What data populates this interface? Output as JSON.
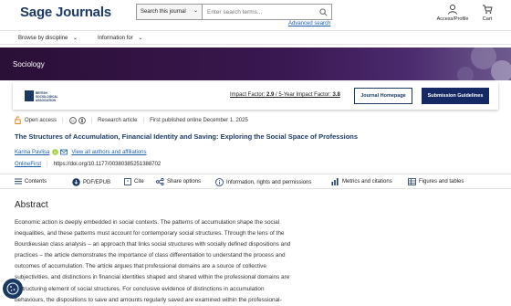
{
  "header": {
    "logo": "Sage Journals",
    "search_scope": "Search this journal",
    "search_placeholder": "Enter search terms...",
    "advanced_search": "Advanced search",
    "account_label": "Access/Profile",
    "cart_label": "Cart"
  },
  "nav": {
    "browse": "Browse by discipline",
    "info": "Information for"
  },
  "banner": {
    "title": "Sociology"
  },
  "journal": {
    "impact_factor_label": "Impact Factor:",
    "impact_factor": "2.9",
    "five_year_label": "5-Year Impact Factor:",
    "five_year": "3.8",
    "home_button": "Journal Homepage",
    "guidelines_button": "Submission Guidelines",
    "logo_text": "BRITISH SOCIOLOGICAL ASSOCIATION"
  },
  "article": {
    "access": "Open access",
    "type": "Research article",
    "published": "First published online December 1, 2025",
    "title": "The Structures of Accumulation, Financial Identity and Saving: Exploring the Social Space of Professions",
    "author": "Karina Pavlisa",
    "all_authors": "View all authors and affiliations",
    "online_first": "OnlineFirst",
    "doi": "https://doi.org/10.1177/00380385251388702"
  },
  "toolbar": {
    "contents": "Contents",
    "pdf": "PDF/EPUB",
    "cite": "Cite",
    "share": "Share options",
    "info": "Information, rights and permissions",
    "metrics": "Metrics and citations",
    "figures": "Figures and tables"
  },
  "abstract": {
    "heading": "Abstract",
    "lines": [
      "Economic action is deeply embedded in social contexts. The patterns of accumulation shape the social",
      "inequalities, and these patterns must account for contemporary social structures. Through the lens of the",
      "Bourdieusian class analysis – an approach that links social structures with socially defined dispositions and",
      "practices – the article demonstrates the importance of class differentiation to understand the process and",
      "outcomes of accumulation. The article argues that professional domains are a source of collective",
      "subjectivities, and distinctions in financial identities shaped and shared within the professional domains are",
      "a structuring element of social structures. For conclusive evidence of distinctions in accumulation",
      "behaviours, the dispositions to save and amounts regularly saved are examined within the professional-"
    ]
  },
  "colors": {
    "brand": "#1b3a63",
    "banner": "#2a0f36",
    "accent_button": "#152a64",
    "link": "#1a5dab"
  }
}
